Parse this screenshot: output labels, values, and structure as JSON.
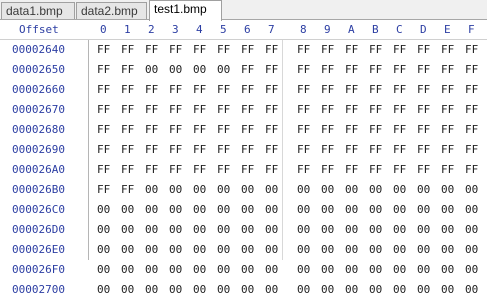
{
  "tabs": [
    {
      "label": "data1.bmp",
      "active": false
    },
    {
      "label": "data2.bmp",
      "active": false
    },
    {
      "label": "test1.bmp",
      "active": true
    }
  ],
  "header": {
    "offset_label": "Offset",
    "columns": [
      "0",
      "1",
      "2",
      "3",
      "4",
      "5",
      "6",
      "7",
      "8",
      "9",
      "A",
      "B",
      "C",
      "D",
      "E",
      "F"
    ]
  },
  "rows": [
    {
      "offset": "00002640",
      "bytes": [
        "FF",
        "FF",
        "FF",
        "FF",
        "FF",
        "FF",
        "FF",
        "FF",
        "FF",
        "FF",
        "FF",
        "FF",
        "FF",
        "FF",
        "FF",
        "FF"
      ]
    },
    {
      "offset": "00002650",
      "bytes": [
        "FF",
        "FF",
        "00",
        "00",
        "00",
        "00",
        "FF",
        "FF",
        "FF",
        "FF",
        "FF",
        "FF",
        "FF",
        "FF",
        "FF",
        "FF"
      ]
    },
    {
      "offset": "00002660",
      "bytes": [
        "FF",
        "FF",
        "FF",
        "FF",
        "FF",
        "FF",
        "FF",
        "FF",
        "FF",
        "FF",
        "FF",
        "FF",
        "FF",
        "FF",
        "FF",
        "FF"
      ]
    },
    {
      "offset": "00002670",
      "bytes": [
        "FF",
        "FF",
        "FF",
        "FF",
        "FF",
        "FF",
        "FF",
        "FF",
        "FF",
        "FF",
        "FF",
        "FF",
        "FF",
        "FF",
        "FF",
        "FF"
      ]
    },
    {
      "offset": "00002680",
      "bytes": [
        "FF",
        "FF",
        "FF",
        "FF",
        "FF",
        "FF",
        "FF",
        "FF",
        "FF",
        "FF",
        "FF",
        "FF",
        "FF",
        "FF",
        "FF",
        "FF"
      ]
    },
    {
      "offset": "00002690",
      "bytes": [
        "FF",
        "FF",
        "FF",
        "FF",
        "FF",
        "FF",
        "FF",
        "FF",
        "FF",
        "FF",
        "FF",
        "FF",
        "FF",
        "FF",
        "FF",
        "FF"
      ]
    },
    {
      "offset": "000026A0",
      "bytes": [
        "FF",
        "FF",
        "FF",
        "FF",
        "FF",
        "FF",
        "FF",
        "FF",
        "FF",
        "FF",
        "FF",
        "FF",
        "FF",
        "FF",
        "FF",
        "FF"
      ]
    },
    {
      "offset": "000026B0",
      "bytes": [
        "FF",
        "FF",
        "00",
        "00",
        "00",
        "00",
        "00",
        "00",
        "00",
        "00",
        "00",
        "00",
        "00",
        "00",
        "00",
        "00"
      ]
    },
    {
      "offset": "000026C0",
      "bytes": [
        "00",
        "00",
        "00",
        "00",
        "00",
        "00",
        "00",
        "00",
        "00",
        "00",
        "00",
        "00",
        "00",
        "00",
        "00",
        "00"
      ]
    },
    {
      "offset": "000026D0",
      "bytes": [
        "00",
        "00",
        "00",
        "00",
        "00",
        "00",
        "00",
        "00",
        "00",
        "00",
        "00",
        "00",
        "00",
        "00",
        "00",
        "00"
      ]
    },
    {
      "offset": "000026E0",
      "bytes": [
        "00",
        "00",
        "00",
        "00",
        "00",
        "00",
        "00",
        "00",
        "00",
        "00",
        "00",
        "00",
        "00",
        "00",
        "00",
        "00"
      ]
    },
    {
      "offset": "000026F0",
      "bytes": [
        "00",
        "00",
        "00",
        "00",
        "00",
        "00",
        "00",
        "00",
        "00",
        "00",
        "00",
        "00",
        "00",
        "00",
        "00",
        "00"
      ]
    },
    {
      "offset": "00002700",
      "bytes": [
        "00",
        "00",
        "00",
        "00",
        "00",
        "00",
        "00",
        "00",
        "00",
        "00",
        "00",
        "00",
        "00",
        "00",
        "00",
        "00"
      ]
    }
  ],
  "colors": {
    "offset_text": "#2c3ea3",
    "byte_text": "#222222",
    "tab_bar_bg": "#f0f0f0"
  }
}
